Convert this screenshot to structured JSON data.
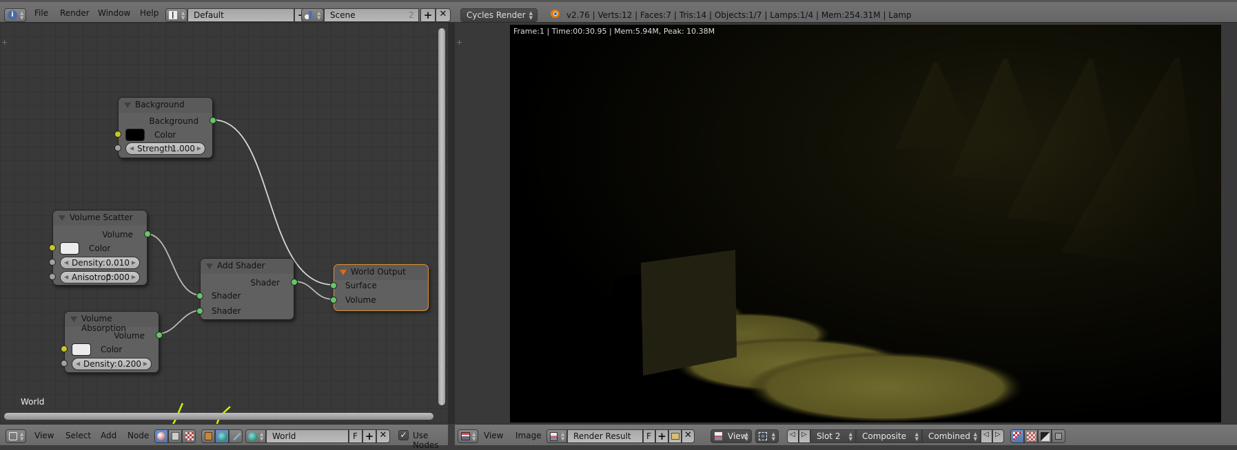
{
  "topbar": {
    "menu": [
      "File",
      "Render",
      "Window",
      "Help"
    ],
    "screen_layout": "Default",
    "scene": "Scene",
    "scene_users": "2",
    "render_engine": "Cycles Render",
    "stats": "v2.76 | Verts:12 | Faces:7 | Tris:14 | Objects:1/7 | Lamps:1/4 | Mem:254.31M | Lamp"
  },
  "node_editor": {
    "context_label": "World",
    "nodes": {
      "background": {
        "title": "Background",
        "output": "Background",
        "color_label": "Color",
        "color": "#000000",
        "strength_label": "Strength:",
        "strength": "1.000"
      },
      "volume_scatter": {
        "title": "Volume Scatter",
        "output": "Volume",
        "color_label": "Color",
        "color": "#ececec",
        "density_label": "Density:",
        "density": "0.010",
        "anisotropy_label": "Anisotrop:",
        "anisotropy": "0.000"
      },
      "volume_absorption": {
        "title": "Volume Absorption",
        "output": "Volume",
        "color_label": "Color",
        "color": "#ececec",
        "density_label": "Density:",
        "density": "0.200"
      },
      "add_shader": {
        "title": "Add Shader",
        "output": "Shader",
        "input1": "Shader",
        "input2": "Shader"
      },
      "world_output": {
        "title": "World Output",
        "input_surface": "Surface",
        "input_volume": "Volume"
      }
    },
    "header": {
      "menu": [
        "View",
        "Select",
        "Add",
        "Node"
      ],
      "datablock": "World",
      "fake_user": "F",
      "use_nodes_label": "Use Nodes",
      "use_nodes_checked": true
    }
  },
  "image_editor": {
    "render_info": "Frame:1 | Time:00:30.95 | Mem:5.94M, Peak: 10.38M",
    "header": {
      "menu": [
        "View",
        "Image"
      ],
      "image_name": "Render Result",
      "fake_user": "F",
      "view_label": "View",
      "slot": "Slot 2",
      "layer": "Composite",
      "pass": "Combined"
    }
  },
  "colors": {
    "accent_blue": "#5a7fbd",
    "socket_shader": "#63c763",
    "socket_color": "#c7c729",
    "socket_value": "#a1a1a1",
    "world_output_border": "#e3962e",
    "annotation_arrow": "#d6f000",
    "spotlight": "#6b6628"
  }
}
